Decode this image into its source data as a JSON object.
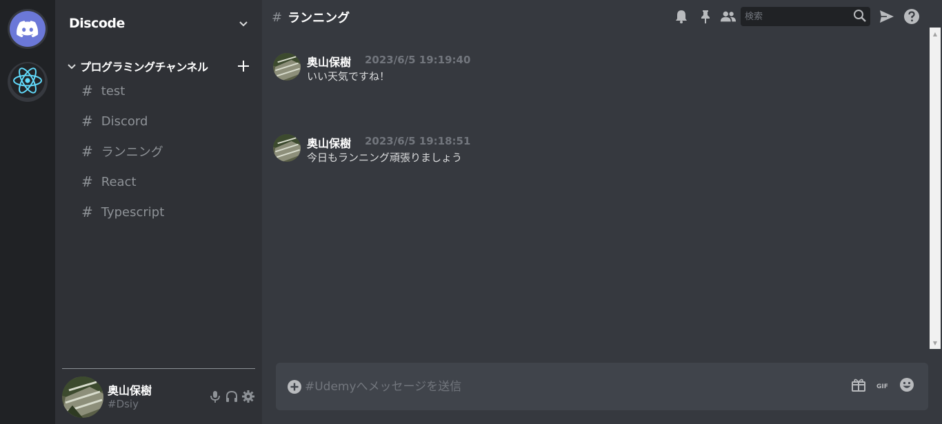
{
  "colors": {
    "rail_bg": "#202225",
    "sidebar_bg": "#2f3136",
    "main_bg": "#36393f",
    "composer_bg": "#40444b",
    "muted": "#8e9297",
    "blurple": "#6b78d8",
    "react_cyan": "#61dafb"
  },
  "servers": [
    {
      "icon": "discord-logo-icon"
    },
    {
      "icon": "react-logo-icon"
    }
  ],
  "server": {
    "name": "Discode"
  },
  "category": {
    "label": "プログラミングチャンネル"
  },
  "channels": [
    {
      "label": "test"
    },
    {
      "label": "Discord"
    },
    {
      "label": "ランニング"
    },
    {
      "label": "React"
    },
    {
      "label": "Typescript"
    }
  ],
  "user": {
    "name": "奥山保樹",
    "tag": "#Dsiy"
  },
  "chat": {
    "channel_name": "ランニング",
    "search_placeholder": "検索",
    "composer_placeholder": "#Udemyへメッセージを送信"
  },
  "messages": [
    {
      "author": "奥山保樹",
      "timestamp": "2023/6/5 19:19:40",
      "text": "いい天気ですね！"
    },
    {
      "author": "奥山保樹",
      "timestamp": "2023/6/5 19:18:51",
      "text": "今日もランニング頑張りましょう"
    }
  ]
}
